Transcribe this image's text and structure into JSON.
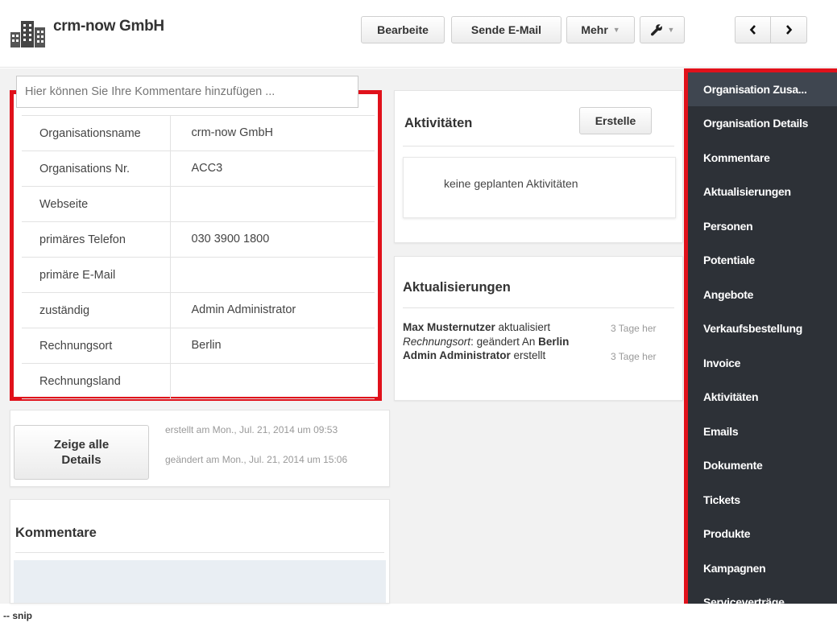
{
  "header": {
    "title": "crm-now GmbH",
    "buttons": {
      "edit": "Bearbeite",
      "email": "Sende E-Mail",
      "more": "Mehr"
    }
  },
  "details": {
    "rows": [
      {
        "label": "Organisationsname",
        "value": "crm-now GmbH"
      },
      {
        "label": "Organisations Nr.",
        "value": "ACC3"
      },
      {
        "label": "Webseite",
        "value": ""
      },
      {
        "label": "primäres Telefon",
        "value": "030 3900 1800"
      },
      {
        "label": "primäre E-Mail",
        "value": ""
      },
      {
        "label": "zuständig",
        "value": "Admin Administrator"
      },
      {
        "label": "Rechnungsort",
        "value": "Berlin"
      },
      {
        "label": "Rechnungsland",
        "value": ""
      }
    ]
  },
  "summary": {
    "show_all_line1": "Zeige alle",
    "show_all_line2": "Details",
    "created": "erstellt am Mon., Jul. 21, 2014 um 09:53",
    "modified": "geändert am Mon., Jul. 21, 2014 um 15:06"
  },
  "comments": {
    "title": "Kommentare",
    "placeholder": "Hier können Sie Ihre Kommentare hinzufügen ..."
  },
  "activities": {
    "title": "Aktivitäten",
    "create_label": "Erstelle",
    "empty_text": "keine geplanten Aktivitäten"
  },
  "updates": {
    "title": "Aktualisierungen",
    "entry1_user": "Max Musternutzer",
    "entry1_action": "aktualisiert",
    "entry1_time": "3 Tage her",
    "entry1_field": "Rechnungsort",
    "entry1_change": ":  geändert An ",
    "entry1_new_value": "Berlin",
    "entry2_user": "Admin Administrator",
    "entry2_action": "erstellt",
    "entry2_time": "3 Tage her"
  },
  "sidebar": {
    "items": [
      {
        "label": "Organisation Zusa..."
      },
      {
        "label": "Organisation Details"
      },
      {
        "label": "Kommentare"
      },
      {
        "label": "Aktualisierungen"
      },
      {
        "label": "Personen"
      },
      {
        "label": "Potentiale"
      },
      {
        "label": "Angebote"
      },
      {
        "label": "Verkaufsbestellung"
      },
      {
        "label": "Invoice"
      },
      {
        "label": "Aktivitäten"
      },
      {
        "label": "Emails"
      },
      {
        "label": "Dokumente"
      },
      {
        "label": "Tickets"
      },
      {
        "label": "Produkte"
      },
      {
        "label": "Kampagnen"
      },
      {
        "label": "Serviceverträge"
      }
    ]
  },
  "footer": {
    "snip": "-- snip"
  },
  "colors": {
    "highlight": "#e0111b",
    "sidebar_bg": "#2d3137",
    "sidebar_active": "#3f4650",
    "content_bg": "#f2f2f2",
    "comment_area": "#e9eef3"
  }
}
